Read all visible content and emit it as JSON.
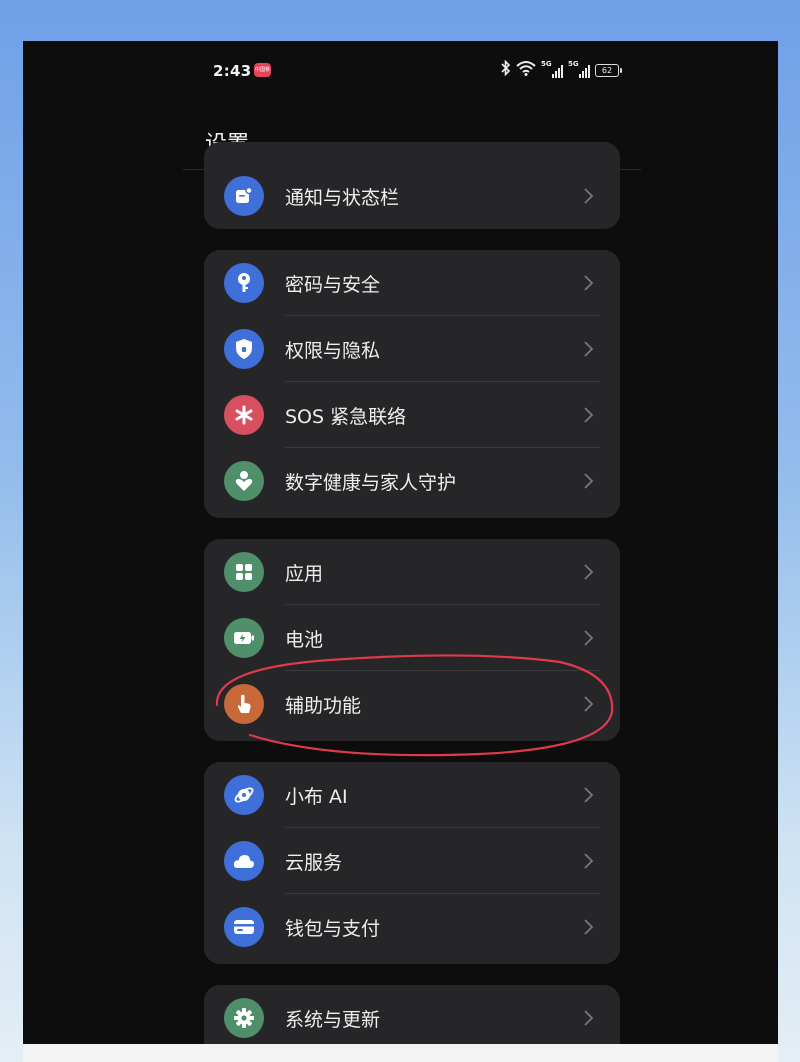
{
  "status_bar": {
    "time": "2:43",
    "carrier_badge": "中国移",
    "signal1_label": "5G",
    "signal2_label": "5G",
    "battery": "62"
  },
  "header": {
    "title": "设置"
  },
  "colors": {
    "blue": "#3f6fd8",
    "green": "#4f8f6a",
    "red": "#d8505f",
    "orange": "#c8693a",
    "annotation": "#e03a4a"
  },
  "groups": [
    {
      "items": [
        {
          "label": "通知与状态栏",
          "icon": "notification-icon"
        }
      ]
    },
    {
      "items": [
        {
          "label": "密码与安全",
          "icon": "key-icon"
        },
        {
          "label": "权限与隐私",
          "icon": "shield-icon"
        },
        {
          "label": "SOS 紧急联络",
          "icon": "asterisk-icon"
        },
        {
          "label": "数字健康与家人守护",
          "icon": "heart-person-icon"
        }
      ]
    },
    {
      "items": [
        {
          "label": "应用",
          "icon": "apps-grid-icon"
        },
        {
          "label": "电池",
          "icon": "battery-icon"
        },
        {
          "label": "辅助功能",
          "icon": "hand-pointer-icon"
        }
      ]
    },
    {
      "items": [
        {
          "label": "小布 AI",
          "icon": "ai-orbit-icon"
        },
        {
          "label": "云服务",
          "icon": "cloud-icon"
        },
        {
          "label": "钱包与支付",
          "icon": "wallet-icon"
        }
      ]
    },
    {
      "items": [
        {
          "label": "系统与更新",
          "icon": "gear-icon"
        }
      ]
    }
  ]
}
